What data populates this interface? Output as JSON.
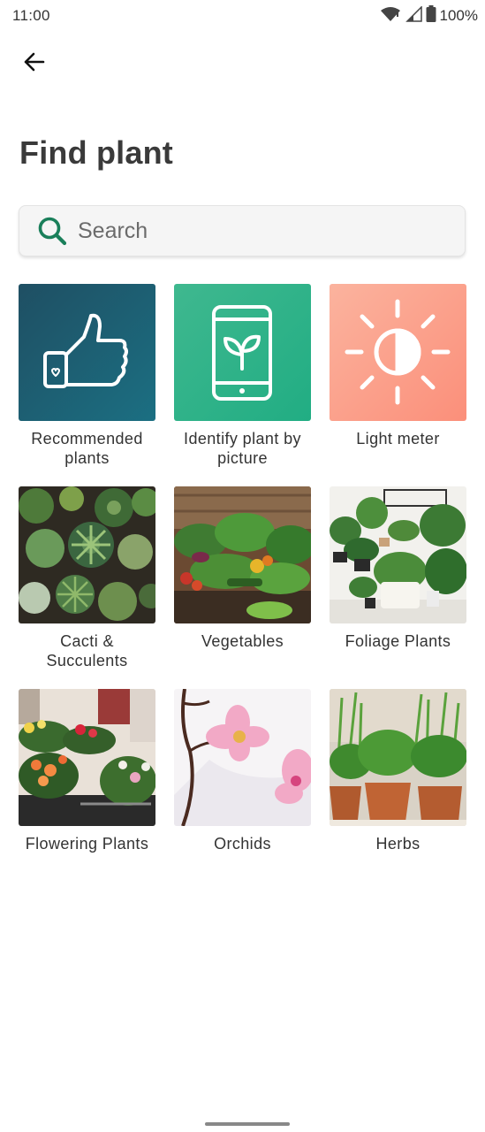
{
  "status": {
    "time": "11:00",
    "battery": "100%",
    "icons": [
      "wifi-icon",
      "signal-icon",
      "battery-icon"
    ]
  },
  "nav": {
    "back_icon": "arrow-left-icon"
  },
  "page": {
    "title": "Find plant"
  },
  "search": {
    "placeholder": "Search",
    "value": "",
    "icon": "search-icon",
    "accent": "#1a7f5a"
  },
  "categories": [
    {
      "label": "Recommended plants",
      "icon": "thumbs-up-icon",
      "bg": "#1d5a6e"
    },
    {
      "label": "Identify plant by picture",
      "icon": "phone-plant-icon",
      "bg": "#2fb38a"
    },
    {
      "label": "Light meter",
      "icon": "sun-icon",
      "bg": "#fb9e86"
    },
    {
      "label": "Cacti & Succulents",
      "icon": "cacti-photo"
    },
    {
      "label": "Vegetables",
      "icon": "vegetables-photo"
    },
    {
      "label": "Foliage Plants",
      "icon": "foliage-photo"
    },
    {
      "label": "Flowering Plants",
      "icon": "flowering-photo"
    },
    {
      "label": "Orchids",
      "icon": "orchids-photo"
    },
    {
      "label": "Herbs",
      "icon": "herbs-photo"
    }
  ]
}
